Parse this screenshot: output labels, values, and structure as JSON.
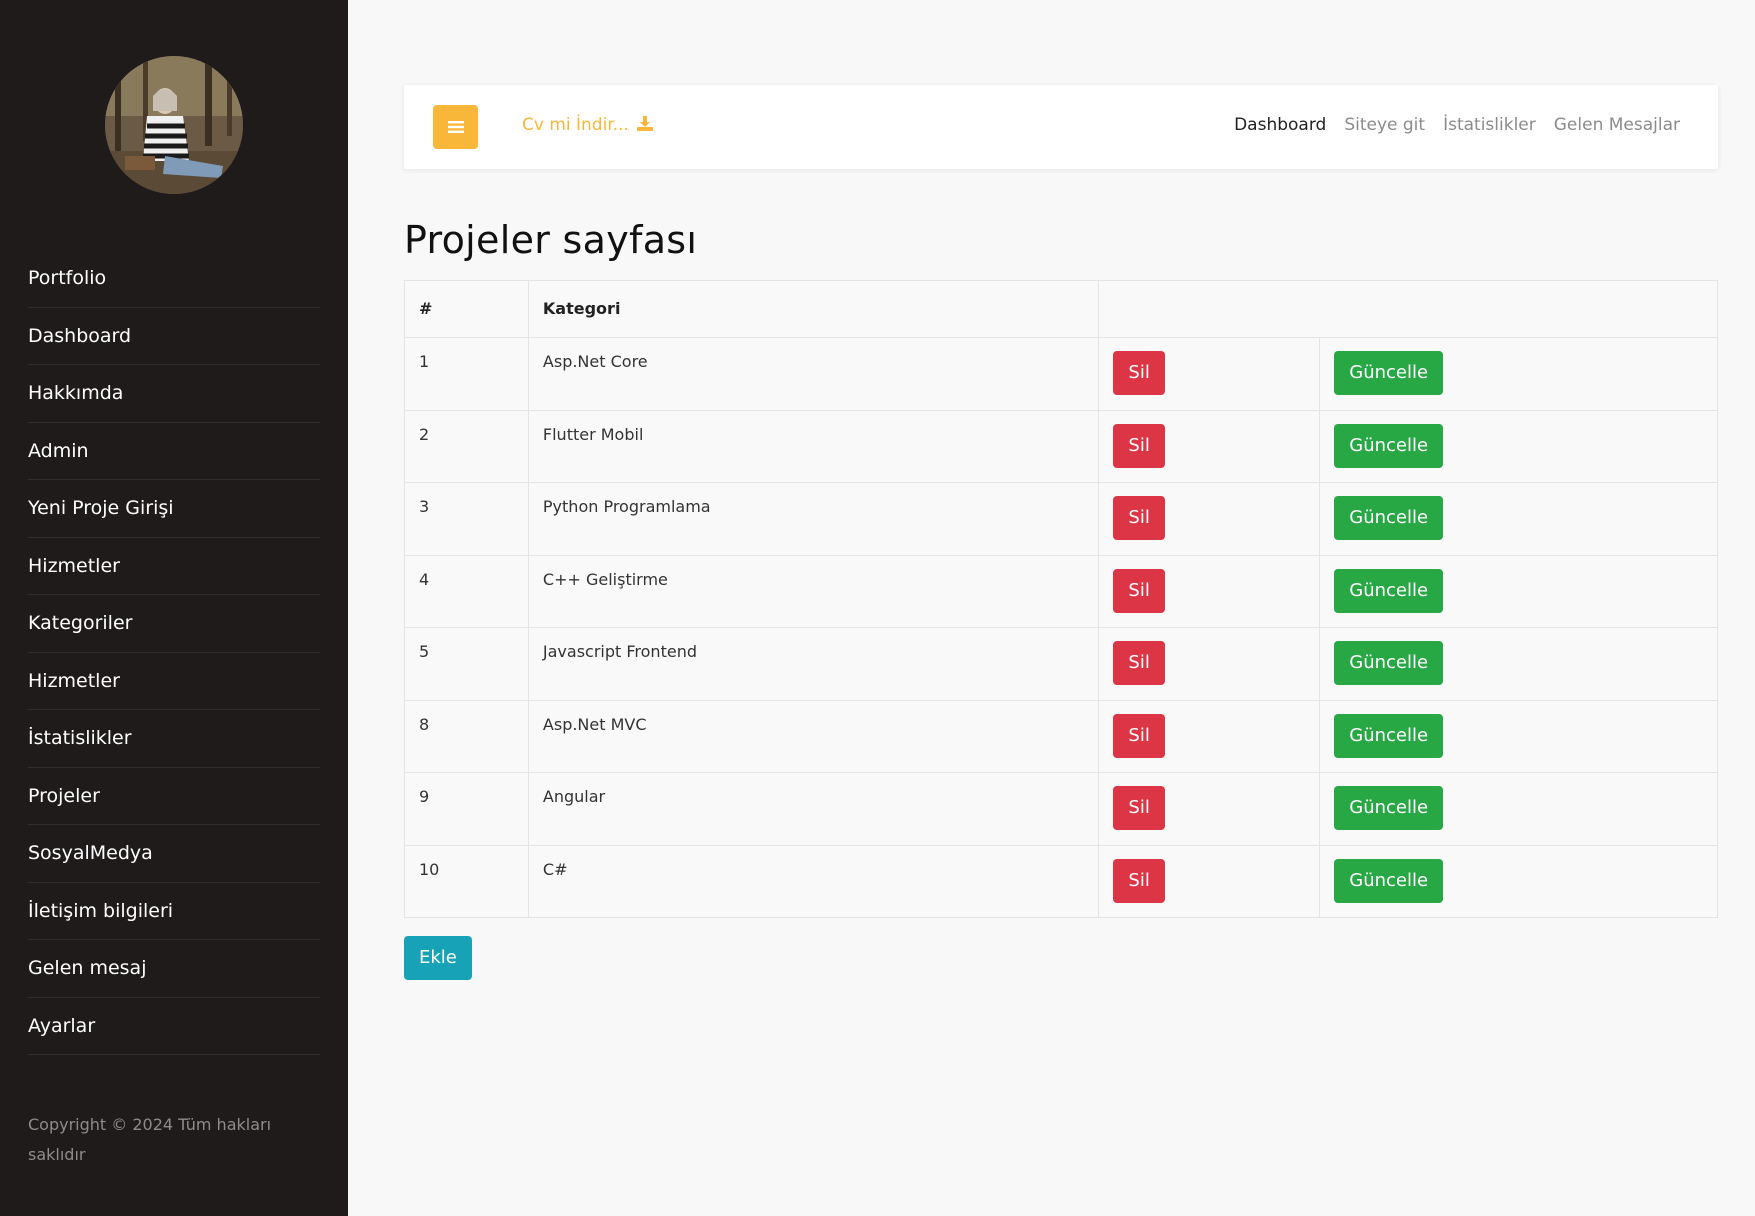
{
  "sidebar": {
    "items": [
      {
        "label": "Portfolio"
      },
      {
        "label": "Dashboard"
      },
      {
        "label": "Hakkımda"
      },
      {
        "label": "Admin"
      },
      {
        "label": "Yeni Proje Girişi"
      },
      {
        "label": "Hizmetler"
      },
      {
        "label": "Kategoriler"
      },
      {
        "label": "Hizmetler"
      },
      {
        "label": "İstatislikler"
      },
      {
        "label": "Projeler"
      },
      {
        "label": "SosyalMedya"
      },
      {
        "label": "İletişim bilgileri"
      },
      {
        "label": "Gelen mesaj"
      },
      {
        "label": "Ayarlar"
      }
    ],
    "copyright": "Copyright © 2024 Tüm hakları saklıdır"
  },
  "navbar": {
    "cv_label": "Cv mi İndir...",
    "links": [
      {
        "label": "Dashboard"
      },
      {
        "label": "Siteye git"
      },
      {
        "label": "İstatislikler"
      },
      {
        "label": "Gelen Mesajlar"
      }
    ]
  },
  "page": {
    "title": "Projeler sayfası"
  },
  "table": {
    "headers": [
      "#",
      "Kategori",
      ""
    ],
    "delete_label": "Sil",
    "update_label": "Güncelle",
    "rows": [
      {
        "id": "1",
        "kategori": "Asp.Net Core"
      },
      {
        "id": "2",
        "kategori": "Flutter Mobil"
      },
      {
        "id": "3",
        "kategori": "Python Programlama"
      },
      {
        "id": "4",
        "kategori": "C++ Geliştirme"
      },
      {
        "id": "5",
        "kategori": "Javascript Frontend"
      },
      {
        "id": "8",
        "kategori": "Asp.Net MVC"
      },
      {
        "id": "9",
        "kategori": "Angular"
      },
      {
        "id": "10",
        "kategori": "C#"
      }
    ]
  },
  "actions": {
    "add_label": "Ekle"
  },
  "colors": {
    "sidebar_bg": "#1f1b1b",
    "accent": "#f8b739",
    "danger": "#dc3545",
    "success": "#28a745",
    "info": "#17a2b8"
  },
  "icons": [
    "bars-icon",
    "download-icon",
    "avatar"
  ]
}
